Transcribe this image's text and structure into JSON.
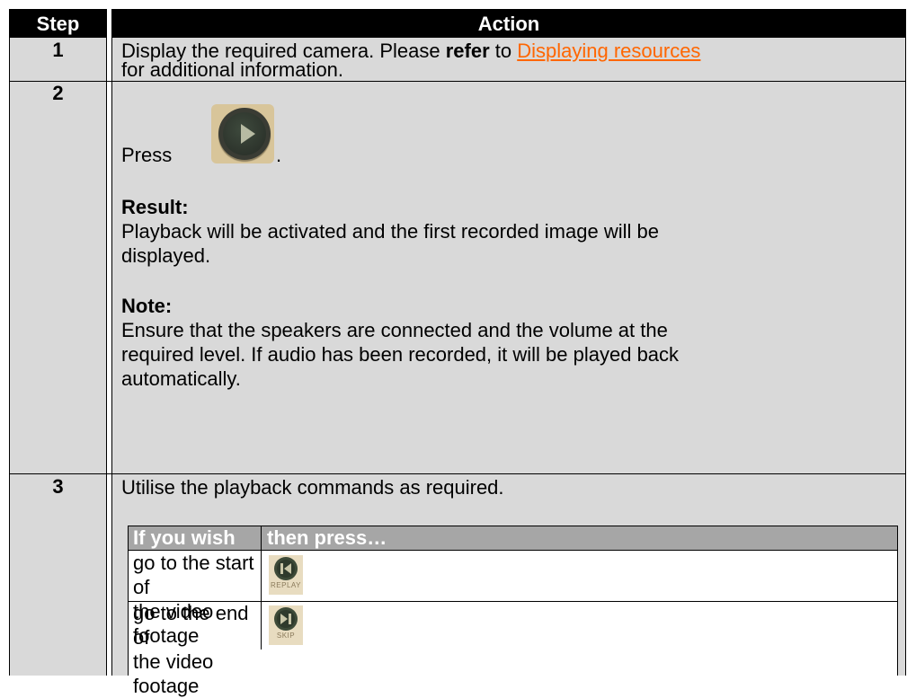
{
  "header": {
    "step": "Step",
    "action": "Action"
  },
  "rows": [
    {
      "step": "1",
      "line1_a": "Display the required camera.  Please ",
      "line1_bold": "refer",
      "line1_b": " to ",
      "link": "Displaying resources",
      "line2": "for additional information."
    },
    {
      "step": "2",
      "press": "Press",
      "press_end": ".",
      "button_icon": "play-button-icon",
      "result_label": "Result:",
      "result_line1": "Playback will be activated and the first recorded image will be",
      "result_line2": "displayed.",
      "note_label": "Note:",
      "note_line1": "Ensure that the speakers are connected and the volume at the",
      "note_line2": "required level.  If audio has been recorded, it will be played back",
      "note_line3": "automatically."
    },
    {
      "step": "3",
      "text": "Utilise the playback commands as required.",
      "subtable": {
        "col1": "If you wish to…",
        "col2": "then press…",
        "rows": [
          {
            "line1": "go to the start of",
            "line2": "the video footage",
            "button_label": "REPLAY",
            "icon": "replay-icon"
          },
          {
            "line1": "go to the end of",
            "line2": "the video footage",
            "button_label": "SKIP",
            "icon": "skip-icon"
          }
        ]
      }
    }
  ],
  "colors": {
    "header_bg": "#000000",
    "cell_bg": "#d9d9d9",
    "link": "#ff6600",
    "subheader_bg": "#a6a6a6"
  }
}
